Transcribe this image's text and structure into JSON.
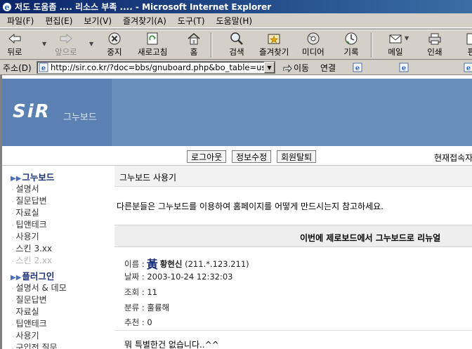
{
  "window": {
    "title": "저도 도움좀 .... 리소스 부족 .... - Microsoft Internet Explorer"
  },
  "menubar": {
    "items": [
      "파일(F)",
      "편집(E)",
      "보기(V)",
      "즐겨찾기(A)",
      "도구(T)",
      "도움말(H)"
    ]
  },
  "toolbar": {
    "back": "뒤로",
    "forward": "앞으로",
    "stop": "중지",
    "refresh": "새로고침",
    "home": "홈",
    "search": "검색",
    "favorites": "즐겨찾기",
    "media": "미디어",
    "history": "기록",
    "mail": "메일",
    "print": "인쇄",
    "edit": "편"
  },
  "address": {
    "label": "주소(D)",
    "url": "http://sir.co.kr/?doc=bbs/gnuboard.php&bo_table=us",
    "go": "이동",
    "links": "연결"
  },
  "site": {
    "logo": "SiR",
    "logo_sub": "그누보드",
    "nav": {
      "logout": "로그아웃",
      "edit_info": "정보수정",
      "withdraw": "회원탈퇴",
      "current_users": "현재접속자"
    }
  },
  "sidebar": {
    "groups": [
      {
        "title": "그누보드",
        "items": [
          "설명서",
          "질문답변",
          "자료실",
          "팁앤테크",
          "사용기",
          "스킨 3.xx",
          "스킨 2.xx"
        ]
      },
      {
        "title": "플러그인",
        "items": [
          "설명서 & 데모",
          "질문답변",
          "자료실",
          "팁앤테크",
          "사용기",
          "구입전 질문"
        ]
      }
    ]
  },
  "board": {
    "title": "그누보드 사용기",
    "description": "다른분들은 그누보드를 이용하여 홈페이지를 어떻게 만드시는지 참고하세요.",
    "post": {
      "title": "이번에 제로보드에서 그누보드로 리뉴얼",
      "name_label": "이름 :",
      "name_icon": "黃",
      "name": "황현신",
      "ip": "(211.*.123.211)",
      "date_label": "날짜 :",
      "date": "2003-10-24 12:32:03",
      "views_label": "조회 :",
      "views": "11",
      "category_label": "분류 :",
      "category": "훌륭해",
      "recommend_label": "추천 :",
      "recommend": "0",
      "body": "뭐 특별한건 없습니다..^^"
    }
  },
  "colors": {
    "titlebar_start": "#0a246a",
    "titlebar_end": "#3a6ea5",
    "banner": "#6a8fbf",
    "accent": "#1a2f7a"
  }
}
